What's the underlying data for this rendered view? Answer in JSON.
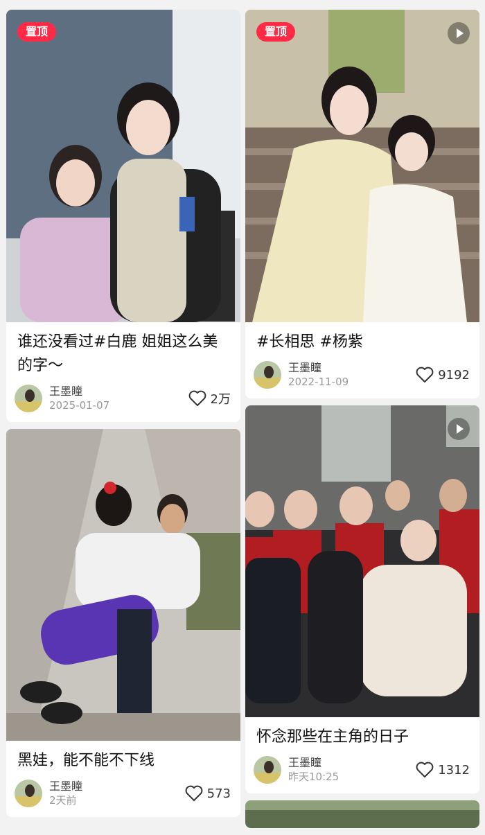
{
  "posts": [
    {
      "title": "谁还没看过#白鹿 姐姐这么美的字～",
      "author": "王墨瞳",
      "date": "2025-01-07",
      "likes": "2万",
      "pinned": "置顶"
    },
    {
      "title": "黑娃，能不能不下线",
      "author": "王墨瞳",
      "date": "2天前",
      "likes": "573"
    },
    {
      "title": "#长相思 #杨紫",
      "author": "王墨瞳",
      "date": "2022-11-09",
      "likes": "9192",
      "pinned": "置顶"
    },
    {
      "title": "怀念那些在主角的日子",
      "author": "王墨瞳",
      "date": "昨天10:25",
      "likes": "1312"
    }
  ],
  "icons": {
    "like": "heart-outline-icon",
    "video": "play-icon",
    "avatar": "author-avatar"
  },
  "colors": {
    "pin_badge": "#ff2a45",
    "text": "#111111",
    "muted": "#999999"
  }
}
